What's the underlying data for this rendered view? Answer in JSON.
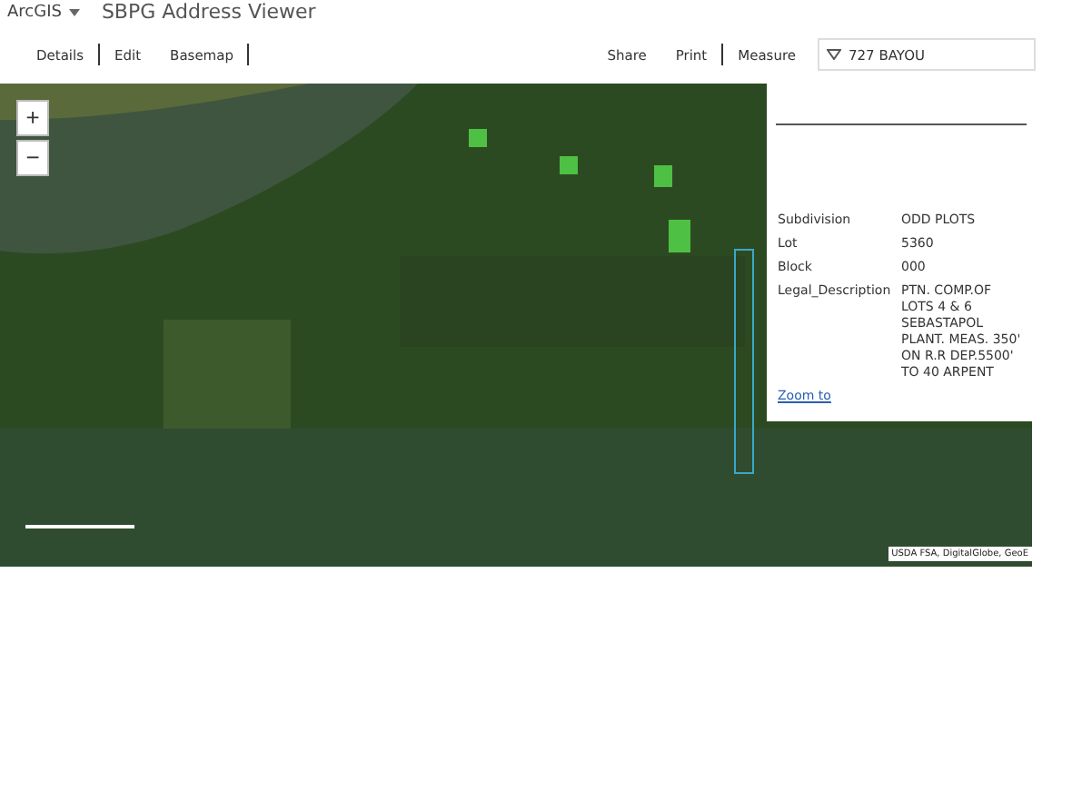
{
  "header": {
    "brand": "ArcGIS",
    "title": "SBPG Address Viewer"
  },
  "toolbar_left": [
    "Details",
    "Edit",
    "Basemap"
  ],
  "toolbar_right": [
    "Share",
    "Print",
    "Measure"
  ],
  "search": {
    "value": "727 BAYOU"
  },
  "map": {
    "zoom_in": "+",
    "zoom_out": "−",
    "attribution": "USDA FSA, DigitalGlobe, GeoE"
  },
  "popup": {
    "fields": [
      {
        "label": "Subdivision",
        "value": "ODD PLOTS"
      },
      {
        "label": "Lot",
        "value": "5360"
      },
      {
        "label": "Block",
        "value": "000"
      },
      {
        "label": "Legal_Description",
        "value": "PTN. COMP.OF LOTS 4 & 6 SEBASTAPOL PLANT. MEAS. 350' ON R.R DEP.5500' TO 40 ARPENT"
      }
    ],
    "link": "Zoom to"
  }
}
